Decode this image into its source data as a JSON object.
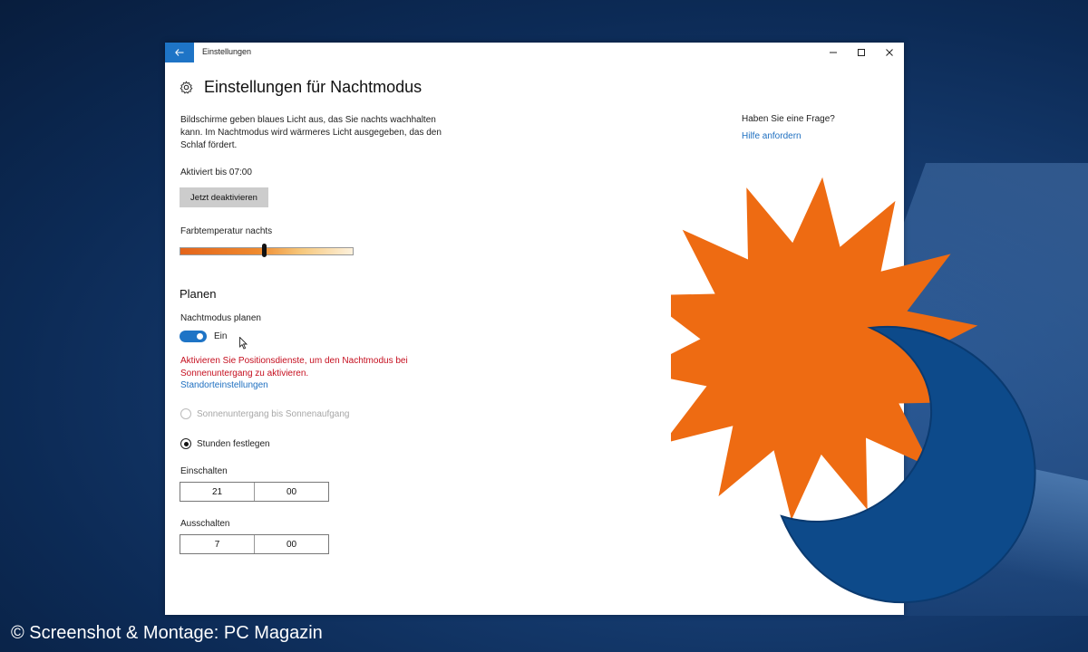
{
  "window": {
    "title": "Einstellungen",
    "controls": [
      "minimize",
      "maximize",
      "close"
    ]
  },
  "page": {
    "title": "Einstellungen für Nachtmodus",
    "description": "Bildschirme geben blaues Licht aus, das Sie nachts wachhalten kann. Im Nachtmodus wird wärmeres Licht ausgegeben, das den Schlaf fördert.",
    "active_until": "Aktiviert bis 07:00",
    "deactivate_button": "Jetzt deaktivieren",
    "color_temp_label": "Farbtemperatur nachts",
    "color_temp_level": 0.49
  },
  "schedule": {
    "section_title": "Planen",
    "toggle_label": "Nachtmodus planen",
    "toggle_state": "Ein",
    "toggle_on": true,
    "warning": "Aktivieren Sie Positionsdienste, um den Nachtmodus bei Sonnenuntergang zu aktivieren.",
    "location_link": "Standorteinstellungen",
    "option_sunset": "Sonnenuntergang bis Sonnenaufgang",
    "option_hours": "Stunden festlegen",
    "turn_on_label": "Einschalten",
    "turn_on_hour": "21",
    "turn_on_minute": "00",
    "turn_off_label": "Ausschalten",
    "turn_off_hour": "7",
    "turn_off_minute": "00"
  },
  "sidebar": {
    "question": "Haben Sie eine Frage?",
    "help_link": "Hilfe anfordern"
  },
  "colors": {
    "accent": "#1e74c6",
    "warning": "#c50f1f",
    "sun": "#ee6b12",
    "moon": "#0d4a8a"
  },
  "caption": "© Screenshot & Montage: PC Magazin"
}
